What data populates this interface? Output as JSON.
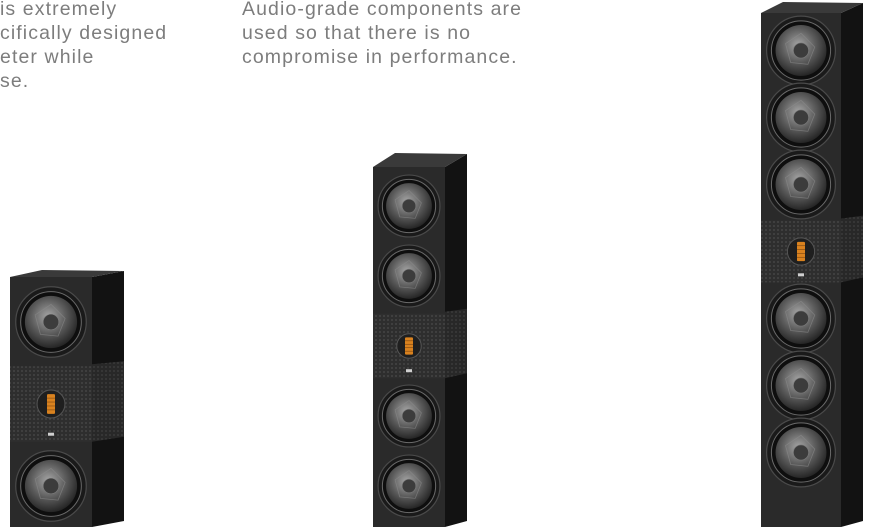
{
  "feature_text": {
    "left_lines": [
      "is extremely",
      "cifically designed",
      "eter while",
      "se."
    ],
    "middle_lines": [
      "Audio-grade components are",
      "used so that there is no",
      "compromise in performance."
    ]
  },
  "products": [
    {
      "driver_layout": [
        "woofer",
        "tweeter",
        "woofer"
      ]
    },
    {
      "driver_layout": [
        "woofer",
        "woofer",
        "tweeter",
        "woofer",
        "woofer"
      ]
    },
    {
      "driver_layout": [
        "woofer",
        "woofer",
        "woofer",
        "tweeter",
        "woofer",
        "woofer",
        "woofer"
      ]
    }
  ],
  "colors": {
    "text": "#7d7d7d",
    "cabinet_front": "#2a2a2a",
    "cabinet_side": "#121212",
    "tweeter_ribbon": "#d9821f"
  }
}
